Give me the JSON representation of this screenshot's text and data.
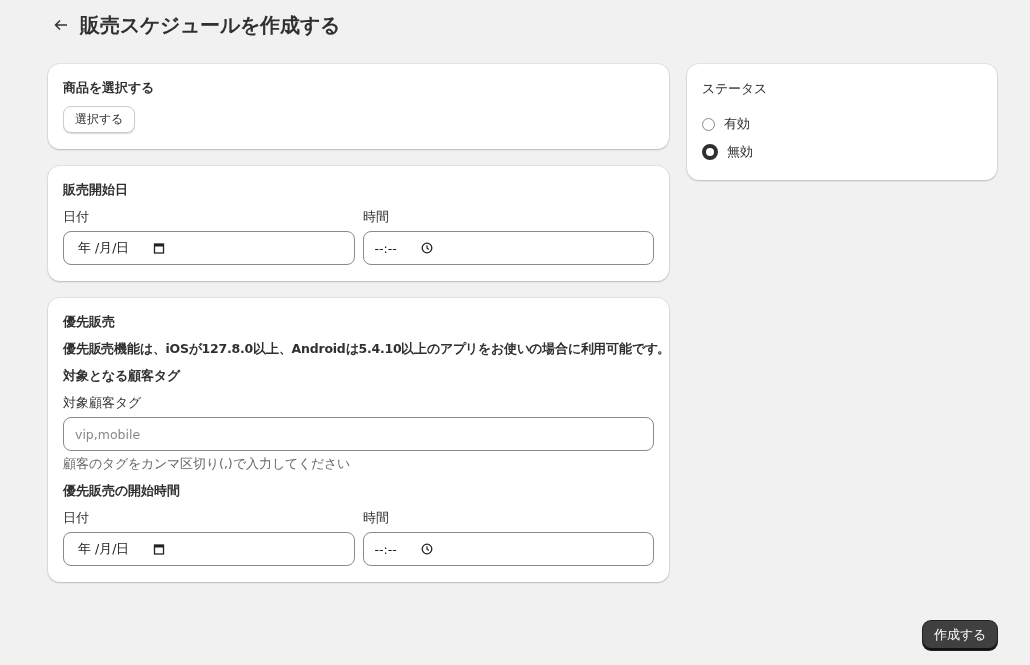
{
  "header": {
    "title": "販売スケジュールを作成する"
  },
  "product_card": {
    "title": "商品を選択する",
    "button": "選択する"
  },
  "start_card": {
    "title": "販売開始日",
    "date": {
      "label": "日付",
      "placeholder": "年 /月/日"
    },
    "time": {
      "label": "時間",
      "placeholder": "--:--"
    }
  },
  "priority_card": {
    "title": "優先販売",
    "notice": "優先販売機能は、iOSが127.8.0以上、Androidは5.4.10以上のアプリをお使いの場合に利用可能です。",
    "tag_heading": "対象となる顧客タグ",
    "tag_field": {
      "label": "対象顧客タグ",
      "placeholder": "vip,mobile",
      "help": "顧客のタグをカンマ区切り(,)で入力してください"
    },
    "start_heading": "優先販売の開始時間",
    "date": {
      "label": "日付",
      "placeholder": "年 /月/日"
    },
    "time": {
      "label": "時間",
      "placeholder": "--:--"
    }
  },
  "status_card": {
    "title": "ステータス",
    "options": [
      {
        "label": "有効",
        "selected": false
      },
      {
        "label": "無効",
        "selected": true
      }
    ]
  },
  "submit_button": "作成する"
}
